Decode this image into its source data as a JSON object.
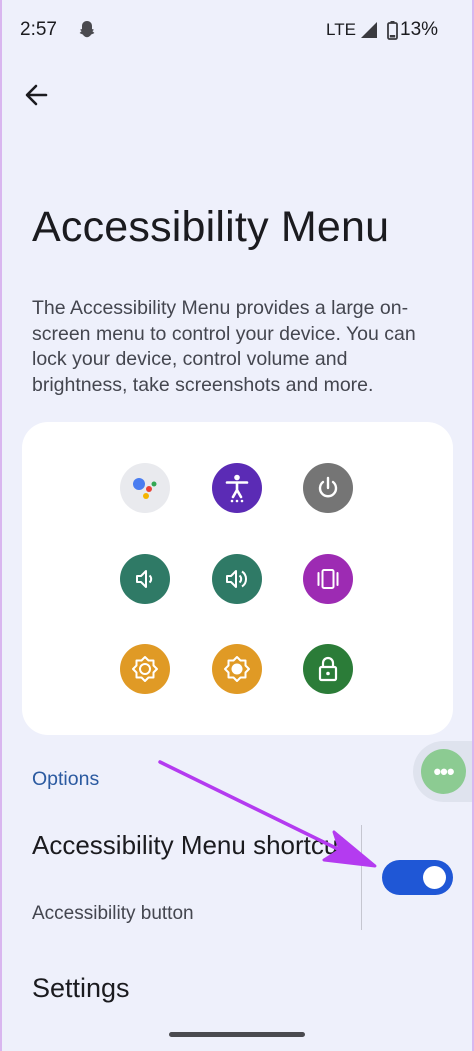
{
  "status_bar": {
    "time": "2:57",
    "network": "LTE",
    "battery": "13%",
    "icons": [
      "snapchat-icon",
      "signal-icon",
      "battery-icon"
    ]
  },
  "header": {
    "back_icon": "arrow-back-icon"
  },
  "page": {
    "title": "Accessibility Menu",
    "description": "The Accessibility Menu provides a large on-screen menu to control your device. You can lock your device, control volume and brightness, take screenshots and more."
  },
  "menu_preview": {
    "icons": [
      {
        "name": "assistant-icon",
        "color": "#e9eaee"
      },
      {
        "name": "accessibility-settings-icon",
        "color": "#5b2bb5"
      },
      {
        "name": "power-icon",
        "color": "#757575"
      },
      {
        "name": "volume-down-icon",
        "color": "#2f7a66"
      },
      {
        "name": "volume-up-icon",
        "color": "#2f7a66"
      },
      {
        "name": "recent-apps-icon",
        "color": "#9d2bb3"
      },
      {
        "name": "brightness-down-icon",
        "color": "#e09a25"
      },
      {
        "name": "brightness-up-icon",
        "color": "#e09a25"
      },
      {
        "name": "lock-icon",
        "color": "#2b7c38"
      }
    ]
  },
  "options": {
    "heading": "Options",
    "shortcut": {
      "title": "Accessibility Menu shortcut",
      "subtitle": "Accessibility button",
      "enabled": true
    },
    "settings_label": "Settings"
  },
  "floating_button": {
    "icon": "more-dots-icon",
    "label": "•••"
  },
  "colors": {
    "background": "#eef0fb",
    "toggle_on": "#1f57d6",
    "annotation_arrow": "#b43bf0",
    "options_heading": "#2b5aa0"
  }
}
